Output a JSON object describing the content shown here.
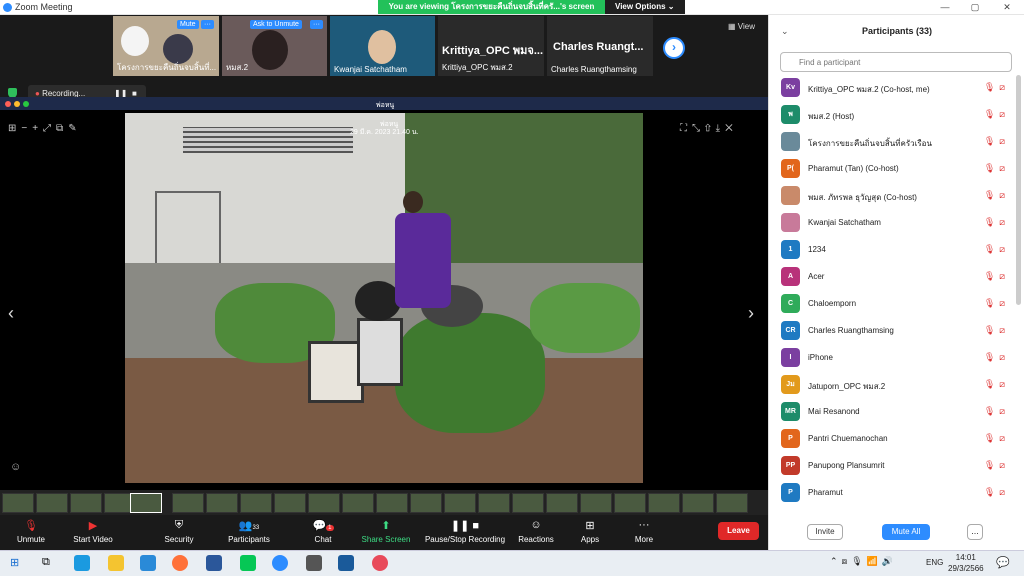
{
  "window": {
    "title": "Zoom Meeting"
  },
  "banner": {
    "text": "You are viewing โครงการขยะคืนถิ่นจบสิ้นที่ครั...'s screen",
    "options": "View Options"
  },
  "thumbs": [
    {
      "name": "โครงการขยะคืนถิ่นจบสิ้นที่...",
      "btn": "Mute"
    },
    {
      "name": "หมส.2",
      "btn": "Ask to Unmute"
    },
    {
      "name": "Kwanjai Satchatham"
    },
    {
      "big": "Krittiya_OPC พมจ...",
      "name": "Krittiya_OPC พมส.2"
    },
    {
      "big": "Charles Ruangt...",
      "name": "Charles Ruangthamsing"
    }
  ],
  "view_label": "View",
  "recording": "Recording...",
  "share_window_title": "พ่อหนู",
  "photo": {
    "title": "พ่อหนู",
    "date": "29 มี.ค. 2023 21.40 น."
  },
  "toolbar": [
    {
      "label": "Unmute",
      "icon": "microphone-muted-icon"
    },
    {
      "label": "Start Video",
      "icon": "video-off-icon"
    },
    {
      "label": "Security",
      "icon": "shield-icon"
    },
    {
      "label": "Participants",
      "icon": "people-icon",
      "count": "33"
    },
    {
      "label": "Chat",
      "icon": "chat-icon",
      "badge": "1"
    },
    {
      "label": "Share Screen",
      "icon": "share-screen-icon"
    },
    {
      "label": "Pause/Stop Recording",
      "icon": "record-icon"
    },
    {
      "label": "Reactions",
      "icon": "reaction-icon"
    },
    {
      "label": "Apps",
      "icon": "apps-icon"
    },
    {
      "label": "More",
      "icon": "more-icon"
    }
  ],
  "leave": "Leave",
  "participants": {
    "title": "Participants (33)",
    "search_placeholder": "Find a participant",
    "list": [
      {
        "initials": "Kv",
        "name": "Krittiya_OPC พมส.2 (Co-host, me)",
        "color": "#7b3fa0"
      },
      {
        "initials": "พ",
        "name": "พมส.2 (Host)",
        "color": "#1d8c6a"
      },
      {
        "initials": "",
        "name": "โครงการขยะคืนถิ่นจบสิ้นที่ครัวเรือน",
        "color": "#6a8a9a"
      },
      {
        "initials": "P(",
        "name": "Pharamut (Tan) (Co-host)",
        "color": "#e2661c"
      },
      {
        "initials": "",
        "name": "พมส. ภัทรพล ธุวัญสุด (Co-host)",
        "color": "#c98a6a"
      },
      {
        "initials": "",
        "name": "Kwanjai Satchatham",
        "color": "#c87a9a"
      },
      {
        "initials": "1",
        "name": "1234",
        "color": "#1f7ac2"
      },
      {
        "initials": "A",
        "name": "Acer",
        "color": "#b8327a"
      },
      {
        "initials": "C",
        "name": "Chaloemporn",
        "color": "#2fab5a"
      },
      {
        "initials": "CR",
        "name": "Charles Ruangthamsing",
        "color": "#1f7ac2"
      },
      {
        "initials": "I",
        "name": "iPhone",
        "color": "#7b3fa0"
      },
      {
        "initials": "Jม",
        "name": "Jatuporn_OPC พมส.2",
        "color": "#e29a1c"
      },
      {
        "initials": "MR",
        "name": "Mai Resanond",
        "color": "#1d8c6a"
      },
      {
        "initials": "P",
        "name": "Pantri Chuemanochan",
        "color": "#e2661c"
      },
      {
        "initials": "PP",
        "name": "Panupong Plansumrit",
        "color": "#c23a2a"
      },
      {
        "initials": "P",
        "name": "Pharamut",
        "color": "#1f7ac2"
      }
    ],
    "invite": "Invite",
    "mute_all": "Mute All",
    "more": "..."
  },
  "taskbar": {
    "lang": "ENG",
    "time": "14:01",
    "date": "29/3/2566"
  }
}
